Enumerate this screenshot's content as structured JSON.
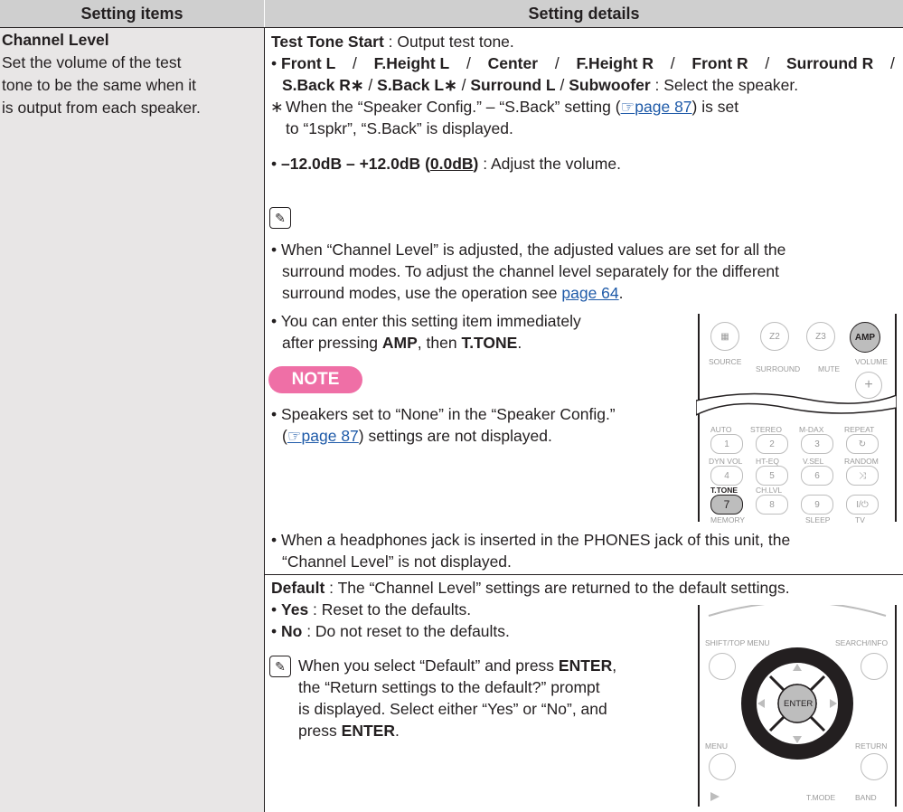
{
  "header": {
    "left": "Setting items",
    "right": "Setting details"
  },
  "left": {
    "title": "Channel Level",
    "desc1": "Set the volume of the test",
    "desc2": "tone to be the same when it",
    "desc3": "is output from each speaker."
  },
  "test_tone": {
    "label": "Test Tone Start",
    "text": " : Output test tone."
  },
  "speakers": {
    "l1": [
      "Front L",
      "F.Height L",
      "Center",
      "F.Height R",
      "Front R",
      "Surround R"
    ],
    "l2": [
      "S.Back R∗",
      "S.Back L∗",
      "Surround L",
      "Subwoofer"
    ],
    "l2_tail": " : Select the speaker.",
    "ast_mark": "∗",
    "ast1a": "When the “Speaker Config.” – “S.Back” setting (",
    "ast_link": "page 87",
    "ast1b": ") is set",
    "ast2": "to “1spkr”, “S.Back” is displayed."
  },
  "volume": {
    "range": "–12.0dB – +12.0dB",
    "default": "0.0dB",
    "text": " : Adjust the volume."
  },
  "memo1": {
    "l1": "When “Channel Level” is adjusted, the adjusted values are set for all the",
    "l2": "surround modes. To adjust the channel level separately for the different",
    "l3a": "surround modes, use the operation see ",
    "l3_link": "page 64",
    "l3b": "."
  },
  "memo2": {
    "l1": "You can enter this setting item immediately",
    "l2a": "after pressing ",
    "amp": "AMP",
    "l2b": ", then ",
    "ttone": "T.TONE",
    "l2c": "."
  },
  "note": {
    "badge": "NOTE",
    "l1": "Speakers set to “None” in the “Speaker Config.”",
    "l2a": "(",
    "l2_link": "page 87",
    "l2b": ") settings are not displayed."
  },
  "headphones": {
    "l1": "When a headphones jack is inserted in the PHONES jack of this unit, the",
    "l2": "“Channel Level” is not displayed."
  },
  "default": {
    "label": "Default",
    "text": " : The “Channel Level” settings are returned to the default settings.",
    "yes_label": "Yes",
    "yes_text": " : Reset to the defaults.",
    "no_label": "No",
    "no_text": " : Do not reset to the defaults."
  },
  "memo3": {
    "l1a": "When you select “Default” and press ",
    "enter": "ENTER",
    "l1b": ",",
    "l2": "the “Return settings to the default?” prompt",
    "l3": "is displayed. Select either “Yes” or “No”, and",
    "l4a": "press ",
    "l4b": "."
  },
  "remote1": {
    "z2": "Z2",
    "z3": "Z3",
    "amp": "AMP",
    "source": "SOURCE",
    "surround": "SURROUND",
    "mute": "MUTE",
    "volume": "VOLUME",
    "auto": "AUTO",
    "stereo": "STEREO",
    "mdax": "M-DAX",
    "repeat": "REPEAT",
    "dynvol": "DYN VOL",
    "hteq": "HT-EQ",
    "vsel": "V.SEL",
    "random": "RANDOM",
    "ttone": "T.TONE",
    "chlvl": "CH.LVL",
    "memory": "MEMORY",
    "sleep": "SLEEP",
    "tv": "TV",
    "n1": "1",
    "n2": "2",
    "n3": "3",
    "n4": "4",
    "n5": "5",
    "n6": "6",
    "n7": "7",
    "n8": "8",
    "n9": "9"
  },
  "remote2": {
    "shift": "SHIFT/TOP MENU",
    "search": "SEARCH/INFO",
    "enter": "ENTER",
    "menu": "MENU",
    "return": "RETURN",
    "tmode": "T.MODE",
    "band": "BAND"
  }
}
